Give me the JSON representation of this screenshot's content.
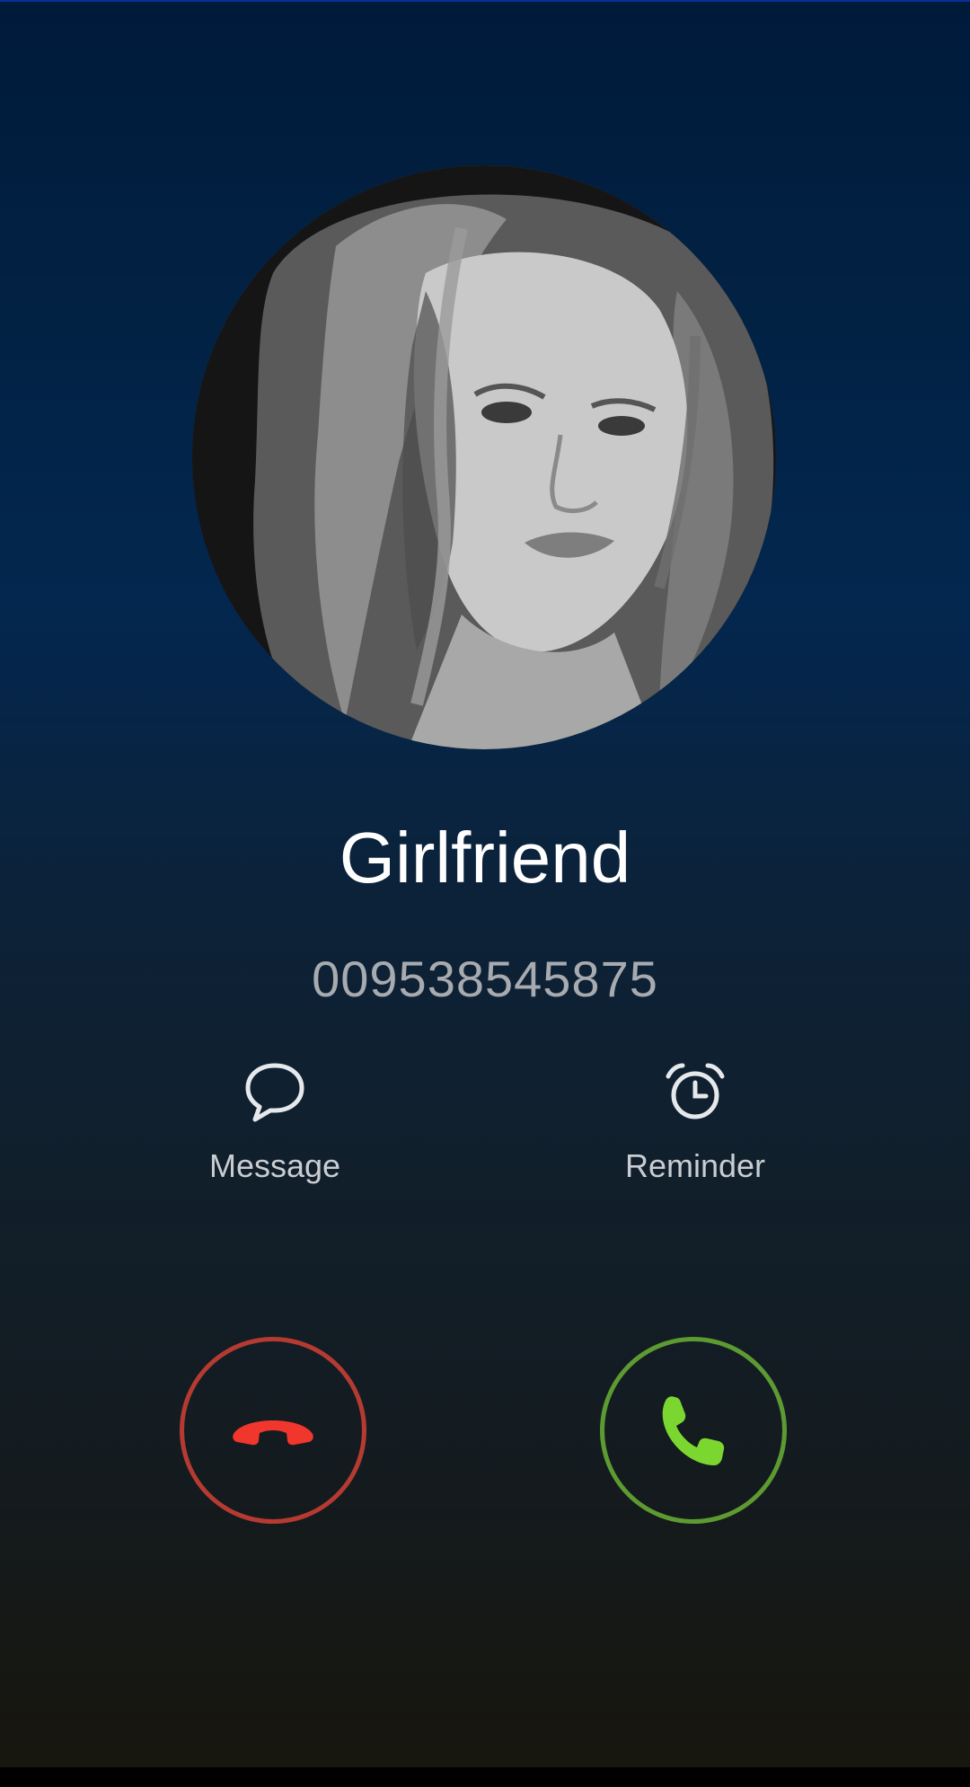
{
  "caller": {
    "name": "Girlfriend",
    "number": "009538545875"
  },
  "actions": {
    "message_label": "Message",
    "reminder_label": "Reminder"
  },
  "icons": {
    "message": "speech-bubble-icon",
    "reminder": "alarm-clock-icon",
    "decline": "phone-hangup-icon",
    "accept": "phone-icon"
  },
  "colors": {
    "decline": "#f0362d",
    "decline_ring": "#b53a32",
    "accept": "#7bd730",
    "accept_ring": "#5d9a31"
  }
}
